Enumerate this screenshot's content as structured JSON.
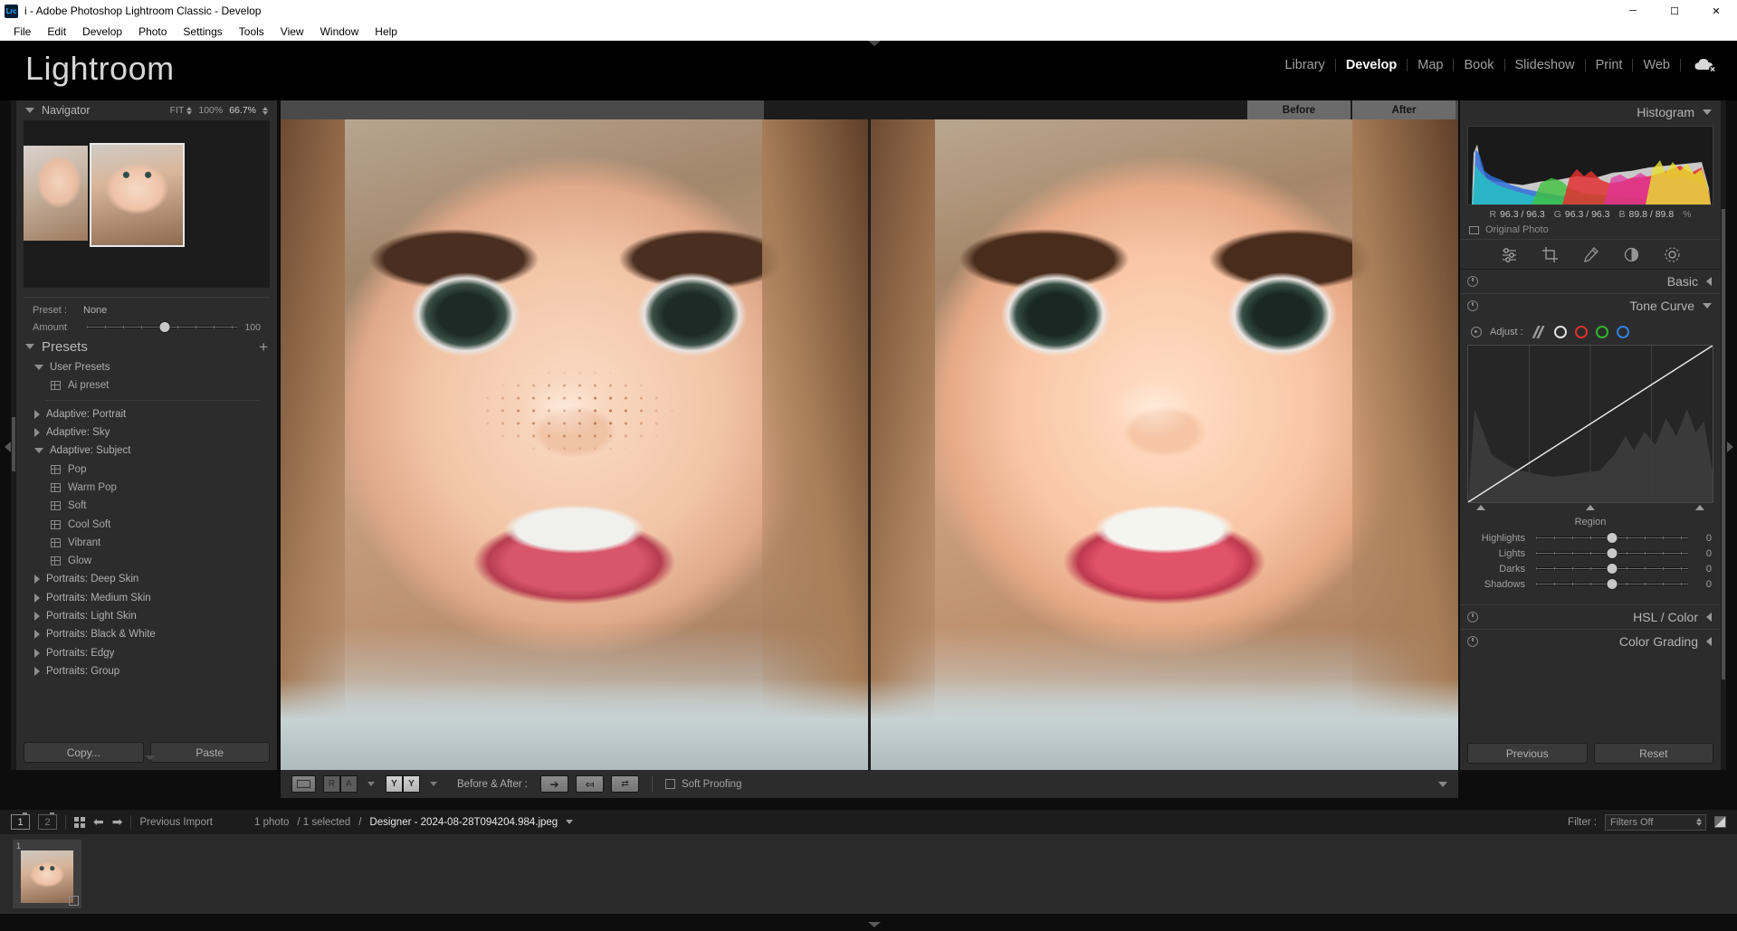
{
  "titlebar": {
    "app_icon": "lrc-logo",
    "title": "i - Adobe Photoshop Lightroom Classic - Develop",
    "minimize": "─",
    "maximize": "☐",
    "close": "✕"
  },
  "menubar": {
    "items": [
      {
        "label": "File"
      },
      {
        "label": "Edit"
      },
      {
        "label": "Develop"
      },
      {
        "label": "Photo"
      },
      {
        "label": "Settings"
      },
      {
        "label": "Tools"
      },
      {
        "label": "View"
      },
      {
        "label": "Window"
      },
      {
        "label": "Help"
      }
    ]
  },
  "header": {
    "wordmark": "Lightroom",
    "modules": [
      {
        "label": "Library",
        "active": false
      },
      {
        "label": "Develop",
        "active": true
      },
      {
        "label": "Map",
        "active": false
      },
      {
        "label": "Book",
        "active": false
      },
      {
        "label": "Slideshow",
        "active": false
      },
      {
        "label": "Print",
        "active": false
      },
      {
        "label": "Web",
        "active": false
      }
    ],
    "cloud_icon": "cloud-sync-off-icon"
  },
  "navigator": {
    "title": "Navigator",
    "fit_label": "FIT",
    "zoom_100": "100%",
    "zoom_current": "66.7%"
  },
  "preset_amount": {
    "preset_label": "Preset :",
    "preset_value": "None",
    "amount_label": "Amount",
    "amount_value": "100",
    "amount_pct": 52
  },
  "presets": {
    "title": "Presets",
    "add_icon": "plus-icon",
    "items": [
      {
        "label": "User Presets",
        "type": "group",
        "expanded": true
      },
      {
        "label": "Ai preset",
        "type": "preset"
      },
      {
        "type": "divider"
      },
      {
        "label": "Adaptive: Portrait",
        "type": "group",
        "expanded": false
      },
      {
        "label": "Adaptive: Sky",
        "type": "group",
        "expanded": false
      },
      {
        "label": "Adaptive: Subject",
        "type": "group",
        "expanded": true
      },
      {
        "label": "Pop",
        "type": "preset"
      },
      {
        "label": "Warm Pop",
        "type": "preset"
      },
      {
        "label": "Soft",
        "type": "preset"
      },
      {
        "label": "Cool Soft",
        "type": "preset"
      },
      {
        "label": "Vibrant",
        "type": "preset"
      },
      {
        "label": "Glow",
        "type": "preset"
      },
      {
        "label": "Portraits: Deep Skin",
        "type": "group",
        "expanded": false
      },
      {
        "label": "Portraits: Medium Skin",
        "type": "group",
        "expanded": false
      },
      {
        "label": "Portraits: Light Skin",
        "type": "group",
        "expanded": false
      },
      {
        "label": "Portraits: Black & White",
        "type": "group",
        "expanded": false
      },
      {
        "label": "Portraits: Edgy",
        "type": "group",
        "expanded": false
      },
      {
        "label": "Portraits: Group",
        "type": "group",
        "expanded": false
      }
    ],
    "copy_label": "Copy...",
    "paste_label": "Paste"
  },
  "image_view": {
    "before_label": "Before",
    "after_label": "After"
  },
  "toolbar": {
    "loupe_icon": "loupe-view-icon",
    "seg_r": "R",
    "seg_a": "A",
    "seg_y1": "Y",
    "seg_y2": "Y",
    "before_after_label": "Before & After :",
    "copy_after_to_before_icon": "arrow-right-icon",
    "copy_before_to_after_icon": "arrow-left-icon",
    "swap_icon": "swap-arrows-icon",
    "soft_proofing_label": "Soft Proofing",
    "soft_proofing_checked": false
  },
  "histogram": {
    "title": "Histogram",
    "shadow_clip_icon": "shadow-clipping-icon",
    "highlight_clip_icon": "highlight-clipping-icon",
    "readout": [
      {
        "channel": "R",
        "value": "96.3 / 96.3"
      },
      {
        "channel": "G",
        "value": "96.3 / 96.3"
      },
      {
        "channel": "B",
        "value": "89.8 / 89.8"
      }
    ],
    "unit": "%",
    "original_photo_label": "Original Photo"
  },
  "tool_strip": {
    "tools": [
      {
        "name": "basic-adjust-icon"
      },
      {
        "name": "crop-overlay-icon"
      },
      {
        "name": "healing-brush-icon"
      },
      {
        "name": "masking-icon"
      },
      {
        "name": "radial-gradient-icon"
      }
    ]
  },
  "panels": {
    "basic": {
      "title": "Basic",
      "expanded": false
    },
    "tone_curve": {
      "title": "Tone Curve",
      "expanded": true
    },
    "hsl_color": {
      "title": "HSL / Color",
      "expanded": false
    },
    "color_grading": {
      "title": "Color Grading",
      "expanded": false
    }
  },
  "tone_curve": {
    "adjust_label": "Adjust :",
    "target_icon": "target-adjust-icon",
    "channels": [
      {
        "name": "parametric-curve-icon",
        "color": "#9a9a9a"
      },
      {
        "name": "rgb-channel-icon",
        "color": "#e0e0e0"
      },
      {
        "name": "red-channel-icon",
        "color": "#e03030"
      },
      {
        "name": "green-channel-icon",
        "color": "#2fb52f"
      },
      {
        "name": "blue-channel-icon",
        "color": "#2f7fe0"
      }
    ],
    "region_label": "Region",
    "sliders": [
      {
        "label": "Highlights",
        "value": "0",
        "pct": 50
      },
      {
        "label": "Lights",
        "value": "0",
        "pct": 50
      },
      {
        "label": "Darks",
        "value": "0",
        "pct": 50
      },
      {
        "label": "Shadows",
        "value": "0",
        "pct": 50
      }
    ]
  },
  "right_footer": {
    "previous_label": "Previous",
    "reset_label": "Reset"
  },
  "filmbar": {
    "screen1": "1",
    "screen2": "2",
    "grid_icon": "grid-view-icon",
    "back_icon": "arrow-back-icon",
    "forward_icon": "arrow-forward-icon",
    "source": "Previous Import",
    "count": "1 photo",
    "selected": "/ 1 selected",
    "separator": "/",
    "filename": "Designer - 2024-08-28T094204.984.jpeg",
    "filter_label": "Filter :",
    "filter_value": "Filters Off"
  },
  "filmstrip": {
    "cells": [
      {
        "index": "1",
        "badge": "◧"
      }
    ]
  }
}
